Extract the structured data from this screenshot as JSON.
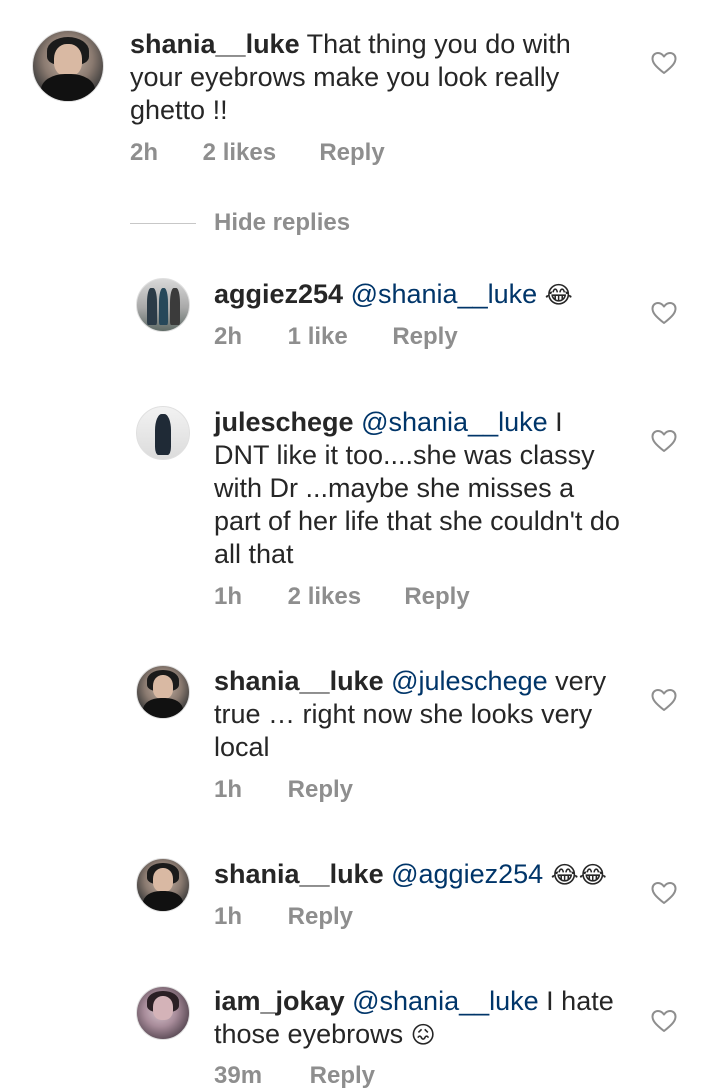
{
  "comments": [
    {
      "username": "shania__luke",
      "mention": "",
      "text": "That thing you do with your eyebrows make you look really ghetto !!",
      "time": "2h",
      "likes": "2 likes",
      "reply": "Reply"
    },
    {
      "username": "aggiez254",
      "mention": "@shania__luke",
      "text": "",
      "emoji": "😂",
      "time": "2h",
      "likes": "1 like",
      "reply": "Reply"
    },
    {
      "username": "juleschege",
      "mention": "@shania__luke",
      "text": "I DNT like it too....she was classy with Dr ...maybe she misses a part of her life that she couldn't do all that",
      "time": "1h",
      "likes": "2 likes",
      "reply": "Reply"
    },
    {
      "username": "shania__luke",
      "mention": "@juleschege",
      "text": "very true … right now she looks very local",
      "time": "1h",
      "likes": "",
      "reply": "Reply"
    },
    {
      "username": "shania__luke",
      "mention": "@aggiez254",
      "text": "",
      "emoji": "😂😂",
      "time": "1h",
      "likes": "",
      "reply": "Reply"
    },
    {
      "username": "iam_jokay",
      "mention": "@shania__luke",
      "text": "I hate those eyebrows",
      "emoji": "😖",
      "time": "39m",
      "likes": "",
      "reply": "Reply"
    }
  ],
  "hide_replies": "Hide replies",
  "icons": {
    "like": "heart-outline-icon"
  },
  "colors": {
    "text": "#262626",
    "mention": "#003569",
    "meta": "#8e8e8e"
  }
}
